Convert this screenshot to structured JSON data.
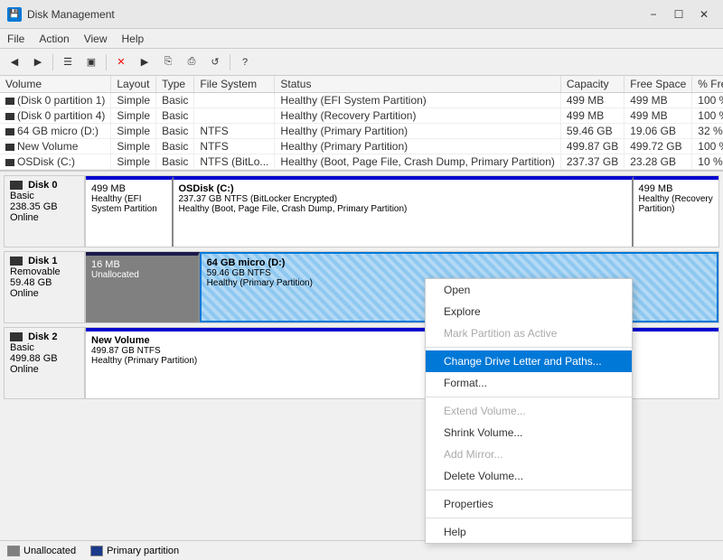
{
  "titleBar": {
    "title": "Disk Management",
    "iconLabel": "DM",
    "controls": [
      "minimize",
      "maximize",
      "close"
    ]
  },
  "menuBar": {
    "items": [
      "File",
      "Action",
      "View",
      "Help"
    ]
  },
  "toolbar": {
    "buttons": [
      "back",
      "forward",
      "up",
      "properties",
      "refresh",
      "delete",
      "explore",
      "copy",
      "paste",
      "undo"
    ]
  },
  "table": {
    "columns": [
      "Volume",
      "Layout",
      "Type",
      "File System",
      "Status",
      "Capacity",
      "Free Space",
      "% Free"
    ],
    "rows": [
      {
        "volume": "(Disk 0 partition 1)",
        "layout": "Simple",
        "type": "Basic",
        "fs": "",
        "status": "Healthy (EFI System Partition)",
        "capacity": "499 MB",
        "free": "499 MB",
        "pct": "100 %"
      },
      {
        "volume": "(Disk 0 partition 4)",
        "layout": "Simple",
        "type": "Basic",
        "fs": "",
        "status": "Healthy (Recovery Partition)",
        "capacity": "499 MB",
        "free": "499 MB",
        "pct": "100 %"
      },
      {
        "volume": "64 GB micro (D:)",
        "layout": "Simple",
        "type": "Basic",
        "fs": "NTFS",
        "status": "Healthy (Primary Partition)",
        "capacity": "59.46 GB",
        "free": "19.06 GB",
        "pct": "32 %"
      },
      {
        "volume": "New Volume",
        "layout": "Simple",
        "type": "Basic",
        "fs": "NTFS",
        "status": "Healthy (Primary Partition)",
        "capacity": "499.87 GB",
        "free": "499.72 GB",
        "pct": "100 %"
      },
      {
        "volume": "OSDisk (C:)",
        "layout": "Simple",
        "type": "Basic",
        "fs": "NTFS (BitLo...",
        "status": "Healthy (Boot, Page File, Crash Dump, Primary Partition)",
        "capacity": "237.37 GB",
        "free": "23.28 GB",
        "pct": "10 %"
      }
    ]
  },
  "disks": [
    {
      "id": "Disk 0",
      "type": "Basic",
      "size": "238.35 GB",
      "status": "Online",
      "partitions": [
        {
          "name": "499 MB",
          "detail": "Healthy (EFI System Partition",
          "size": "499 MB",
          "type": "blue",
          "flex": 1
        },
        {
          "name": "OSDisk (C:)",
          "detail": "237.37 GB NTFS (BitLocker Encrypted)",
          "extra": "Healthy (Boot, Page File, Crash Dump, Primary Partition)",
          "size": "",
          "type": "blue",
          "flex": 6
        },
        {
          "name": "499 MB",
          "detail": "Healthy (Recovery Partition)",
          "size": "",
          "type": "blue",
          "flex": 1
        }
      ]
    },
    {
      "id": "Disk 1",
      "type": "Removable",
      "size": "59.48 GB",
      "status": "Online",
      "partitions": [
        {
          "name": "16 MB",
          "detail": "Unallocated",
          "size": "",
          "type": "dark",
          "flex": 1
        },
        {
          "name": "64 GB micro (D:)",
          "detail": "59.46 GB NTFS",
          "extra": "Healthy (Primary Partition)",
          "size": "",
          "type": "selected-striped",
          "flex": 5
        }
      ]
    },
    {
      "id": "Disk 2",
      "type": "Basic",
      "size": "499.88 GB",
      "status": "Online",
      "partitions": [
        {
          "name": "New Volume",
          "detail": "499.87 GB NTFS",
          "extra": "Healthy (Primary Partition)",
          "size": "",
          "type": "blue",
          "flex": 8
        }
      ]
    }
  ],
  "statusBar": {
    "legend": [
      {
        "label": "Unallocated",
        "type": "unalloc"
      },
      {
        "label": "Primary partition",
        "type": "primary"
      }
    ]
  },
  "contextMenu": {
    "items": [
      {
        "label": "Open",
        "disabled": false,
        "highlighted": false
      },
      {
        "label": "Explore",
        "disabled": false,
        "highlighted": false
      },
      {
        "label": "Mark Partition as Active",
        "disabled": true,
        "highlighted": false
      },
      {
        "separator": true
      },
      {
        "label": "Change Drive Letter and Paths...",
        "disabled": false,
        "highlighted": true
      },
      {
        "label": "Format...",
        "disabled": false,
        "highlighted": false
      },
      {
        "separator": true
      },
      {
        "label": "Extend Volume...",
        "disabled": true,
        "highlighted": false
      },
      {
        "label": "Shrink Volume...",
        "disabled": false,
        "highlighted": false
      },
      {
        "label": "Add Mirror...",
        "disabled": true,
        "highlighted": false
      },
      {
        "label": "Delete Volume...",
        "disabled": false,
        "highlighted": false
      },
      {
        "separator": true
      },
      {
        "label": "Properties",
        "disabled": false,
        "highlighted": false
      },
      {
        "separator": true
      },
      {
        "label": "Help",
        "disabled": false,
        "highlighted": false
      }
    ]
  }
}
